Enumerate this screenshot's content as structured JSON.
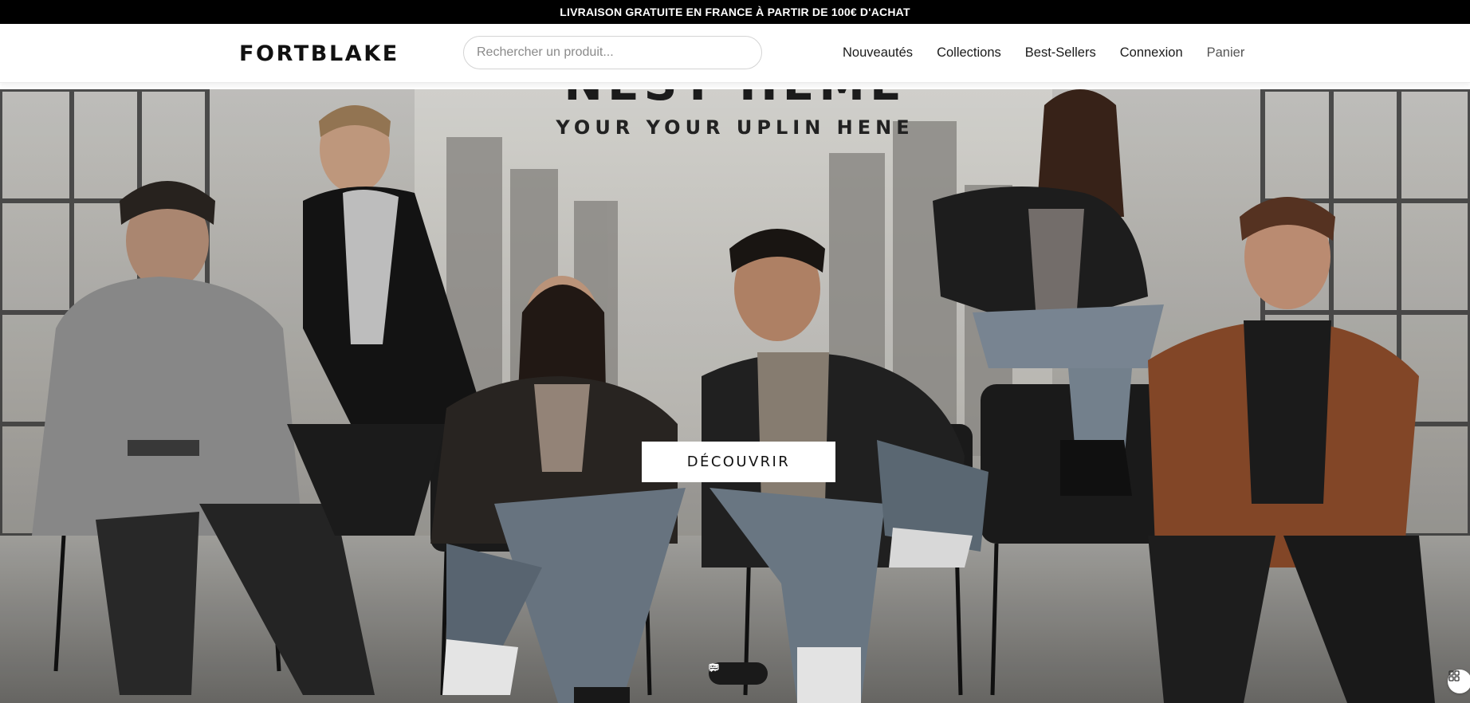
{
  "announcement": {
    "text": "LIVRAISON GRATUITE EN FRANCE À PARTIR DE 100€ D'ACHAT"
  },
  "header": {
    "logo": "FORTBLAKE",
    "search": {
      "placeholder": "Rechercher un produit...",
      "value": ""
    },
    "nav": {
      "items": [
        {
          "label": "Nouveautés"
        },
        {
          "label": "Collections"
        },
        {
          "label": "Best-Sellers"
        },
        {
          "label": "Connexion"
        },
        {
          "label": "Panier"
        }
      ]
    }
  },
  "hero": {
    "headline": "NEST HEME",
    "subline": "YOUR YOUR UPLIN HENE",
    "cta_label": "DÉCOUVRIR",
    "icons": [
      "chat-bubble-icon",
      "add-user-icon",
      "list-icon",
      "grid-icon"
    ]
  },
  "colors": {
    "announcement_bg": "#000000",
    "header_bg": "#ffffff",
    "cta_bg": "#ffffff",
    "hero_tone": "#8d8b87"
  }
}
